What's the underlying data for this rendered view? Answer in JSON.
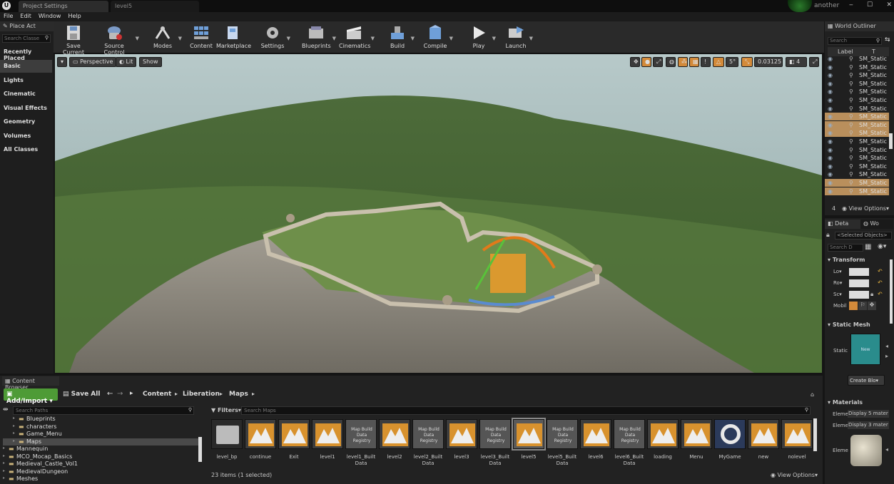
{
  "tabs": [
    {
      "label": "Project Settings"
    },
    {
      "label": "level5"
    }
  ],
  "user": "another",
  "menu": [
    "File",
    "Edit",
    "Window",
    "Help"
  ],
  "toolbar": [
    {
      "label": "Save Current",
      "icon": "save-icon"
    },
    {
      "label": "Source Control",
      "icon": "source-control-icon"
    },
    {
      "label": "Modes",
      "icon": "modes-icon"
    },
    {
      "label": "Content",
      "icon": "content-icon"
    },
    {
      "label": "Marketplace",
      "icon": "marketplace-icon"
    },
    {
      "label": "Settings",
      "icon": "settings-icon"
    },
    {
      "label": "Blueprints",
      "icon": "blueprints-icon"
    },
    {
      "label": "Cinematics",
      "icon": "cinematics-icon"
    },
    {
      "label": "Build",
      "icon": "build-icon"
    },
    {
      "label": "Compile",
      "icon": "compile-icon"
    },
    {
      "label": "Play",
      "icon": "play-icon"
    },
    {
      "label": "Launch",
      "icon": "launch-icon"
    }
  ],
  "place": {
    "tab": "Place Act",
    "search_placeholder": "Search Classe",
    "items": [
      "Recently Placed",
      "Basic",
      "Lights",
      "Cinematic",
      "Visual Effects",
      "Geometry",
      "Volumes",
      "All Classes"
    ]
  },
  "viewport": {
    "perspective": "Perspective",
    "lit": "Lit",
    "show": "Show",
    "angle": "5°",
    "scale": "0.03125",
    "speed": "4"
  },
  "outliner": {
    "title": "World Outliner",
    "search_placeholder": "Search",
    "label_col": "Label",
    "type_col": "T",
    "rows": [
      "SM_Static",
      "SM_Static",
      "SM_Static",
      "SM_Static",
      "SM_Static",
      "SM_Static",
      "SM_Static",
      "SM_Static",
      "SM_Static",
      "SM_Static",
      "SM_Static",
      "SM_Static",
      "SM_Static",
      "SM_Static",
      "SM_Static",
      "SM_Static",
      "SM_Static"
    ],
    "count": "4",
    "view_options": "View Options"
  },
  "details": {
    "tab1": "Deta",
    "tab2": "Wo",
    "selected": "<Selected Objects>",
    "search_placeholder": "Search D",
    "transform": "Transform",
    "loc": "Lo",
    "rot": "Ro",
    "scl": "Sc",
    "mob": "Mobil",
    "static_mesh": "Static Mesh",
    "static": "Static",
    "mesh_new": "New",
    "create_bp": "Create Blo",
    "materials": "Materials",
    "elem1": "Eleme",
    "mat1": "Display 5 mater",
    "elem2": "Eleme",
    "mat2": "Display 3 mater",
    "elem3": "Eleme"
  },
  "cb": {
    "tab": "Content Browser",
    "add_import": "Add/Import",
    "save_all": "Save All",
    "crumbs": [
      "Content",
      "Liberation",
      "Maps"
    ],
    "search_paths": "Search Paths",
    "filters": "Filters",
    "search_maps": "Search Maps",
    "tree": [
      "Blueprints",
      "characters",
      "Game_Menu",
      "Maps",
      "Mannequin",
      "MCO_Mocap_Basics",
      "Medieval_Castle_Vol1",
      "MedievalDungeon",
      "Meshes"
    ],
    "items": [
      "level_bp",
      "continue",
      "Exit",
      "level1",
      "level1_Built Data",
      "level2",
      "level2_Built Data",
      "level3",
      "level3_Built Data",
      "level5",
      "level5_Built Data",
      "level6",
      "level6_Built Data",
      "loading",
      "Menu",
      "MyGame",
      "new",
      "nolevel"
    ],
    "map_build_label": "Map Build Data Registry",
    "status": "23 items (1 selected)",
    "view_options": "View Options"
  }
}
